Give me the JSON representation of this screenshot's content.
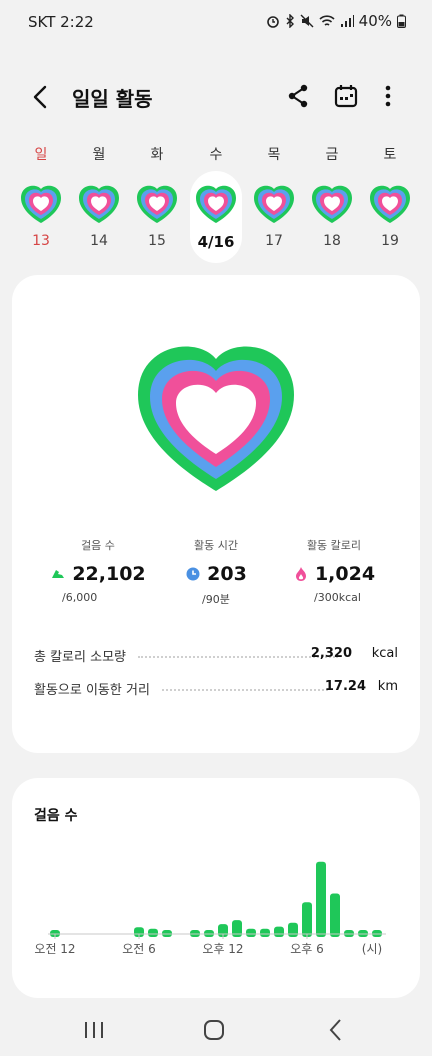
{
  "status": {
    "time": "SKT 2:22",
    "battery": "40%"
  },
  "header": {
    "title": "일일 활동",
    "icons": [
      "back-icon",
      "share-icon",
      "calendar-icon",
      "more-icon"
    ]
  },
  "week": [
    {
      "name": "일",
      "date": "13",
      "sunday": true,
      "selected": false
    },
    {
      "name": "월",
      "date": "14",
      "sunday": false,
      "selected": false
    },
    {
      "name": "화",
      "date": "15",
      "sunday": false,
      "selected": false
    },
    {
      "name": "수",
      "date": "4/16",
      "sunday": false,
      "selected": true
    },
    {
      "name": "목",
      "date": "17",
      "sunday": false,
      "selected": false
    },
    {
      "name": "금",
      "date": "18",
      "sunday": false,
      "selected": false
    },
    {
      "name": "토",
      "date": "19",
      "sunday": false,
      "selected": false
    }
  ],
  "stats": {
    "steps": {
      "label": "걸음 수",
      "value": "22,102",
      "goal": "/6,000",
      "color": "#1fc759"
    },
    "active_time": {
      "label": "활동 시간",
      "value": "203",
      "goal": "/90분",
      "color": "#4a90e2"
    },
    "calories": {
      "label": "활동 칼로리",
      "value": "1,024",
      "goal": "/300kcal",
      "color": "#f0509a"
    }
  },
  "totals": {
    "total_calories": {
      "label": "총 칼로리 소모량",
      "value": "2,320",
      "unit": "kcal"
    },
    "distance": {
      "label": "활동으로 이동한 거리",
      "value": "17.24",
      "unit": "km"
    }
  },
  "steps_card": {
    "title": "걸음 수"
  },
  "colors": {
    "green": "#1fc759",
    "blue": "#5aa0ee",
    "pink": "#f0509a",
    "sunday": "#d64545"
  },
  "chart_data": {
    "type": "bar",
    "title": "걸음 수",
    "categories": [
      "0",
      "1",
      "2",
      "3",
      "4",
      "5",
      "6",
      "7",
      "8",
      "9",
      "10",
      "11",
      "12",
      "13",
      "14",
      "15",
      "16",
      "17",
      "18",
      "19",
      "20",
      "21",
      "22",
      "23"
    ],
    "values": [
      180,
      0,
      0,
      0,
      0,
      0,
      380,
      300,
      230,
      0,
      180,
      180,
      560,
      790,
      300,
      300,
      420,
      640,
      1800,
      4100,
      2300,
      210,
      210,
      210
    ],
    "x_tick_labels": [
      "오전 12",
      "오전 6",
      "오후 12",
      "오후 6",
      "(시)"
    ],
    "x_tick_hours": [
      0,
      6,
      12,
      18
    ],
    "ylim": [
      0,
      4200
    ],
    "grid": false
  }
}
